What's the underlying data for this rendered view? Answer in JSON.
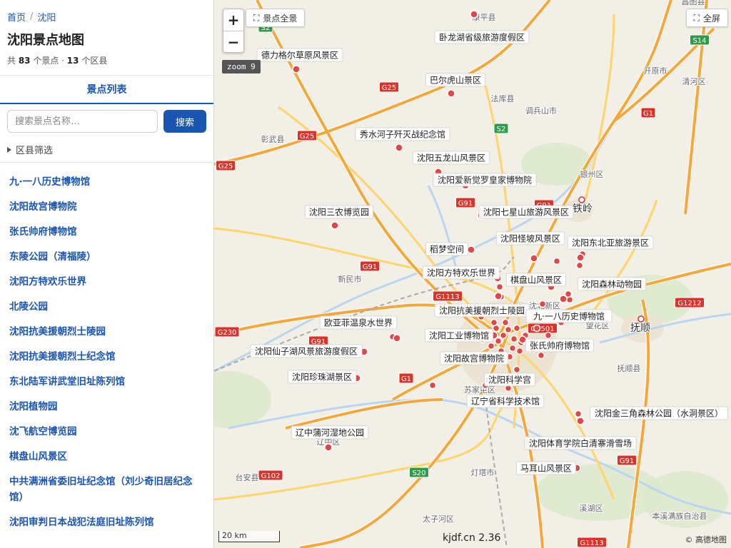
{
  "breadcrumb": {
    "home": "首页",
    "separator": "/",
    "current": "沈阳"
  },
  "title": "沈阳景点地图",
  "stats": {
    "prefix": "共 ",
    "spots": "83",
    "mid": " 个景点 · ",
    "districts": "13",
    "suffix": " 个区县"
  },
  "tab_label": "景点列表",
  "search": {
    "placeholder": "搜索景点名称…",
    "button": "搜索"
  },
  "filter_label": "区县筛选",
  "spots_list": [
    "九·一八历史博物馆",
    "沈阳故宫博物院",
    "张氏帅府博物馆",
    "东陵公园（清福陵）",
    "沈阳方特欢乐世界",
    "北陵公园",
    "沈阳抗美援朝烈士陵园",
    "沈阳抗美援朝烈士纪念馆",
    "东北陆军讲武堂旧址陈列馆",
    "沈阳植物园",
    "沈飞航空博览园",
    "棋盘山风景区",
    "中共满洲省委旧址纪念馆（刘少奇旧居纪念馆）",
    "沈阳审判日本战犯法庭旧址陈列馆"
  ],
  "map": {
    "zoom_in": "+",
    "zoom_out": "−",
    "fit_button": "景点全景",
    "fullscreen_button": "全屏",
    "zoom_badge": "zoom 9",
    "scale_label": "20 km",
    "brand": "kjdf.cn 2.36",
    "attribution": "© 高德地图",
    "spot_labels": [
      "德力格尔草原风景区",
      "卧龙湖省级旅游度假区",
      "巴尔虎山景区",
      "秀水河子歼灭战纪念馆",
      "沈阳五龙山风景区",
      "沈阳爱新觉罗皇家博物院",
      "沈阳三农博览园",
      "沈阳七星山旅游风景区",
      "沈阳怪坡风景区",
      "沈阳东北亚旅游景区",
      "稻梦空间",
      "沈阳方特欢乐世界",
      "棋盘山风景区",
      "沈阳森林动物园",
      "沈阳抗美援朝烈士陵园",
      "九·一八历史博物馆",
      "欧亚菲温泉水世界",
      "沈阳工业博物馆",
      "张氏帅府博物馆",
      "沈阳仙子湖风景旅游度假区",
      "沈阳故宫博物院",
      "沈阳珍珠湖景区",
      "沈阳科学宫",
      "辽宁省科学技术馆",
      "沈阳金三角森林公园（水洞景区）",
      "辽中蒲河湿地公园",
      "沈阳体育学院白清寨滑雪场",
      "马耳山风景区"
    ],
    "place_labels": [
      "康平县",
      "法库县",
      "调兵山市",
      "开原市",
      "清河区",
      "彰武县",
      "银州区",
      "铁岭",
      "新民市",
      "沈北新区",
      "望花区",
      "抚顺",
      "抚顺县",
      "苏家屯区",
      "辽中区",
      "台安县",
      "灯塔市",
      "太子河区",
      "溪湖区",
      "本溪满族自治县",
      "昌图县"
    ],
    "road_shields": [
      "S2",
      "G25",
      "G25",
      "G25",
      "S2",
      "G91",
      "G91",
      "G91",
      "G1113",
      "G1212",
      "G230",
      "G91",
      "G1",
      "G102",
      "S20",
      "G91",
      "S14",
      "G1",
      "G1501",
      "G1113"
    ]
  },
  "colors": {
    "accent": "#1a55b0",
    "marker": "#e04848",
    "highway": "#f4a73a",
    "road": "#ffd56a",
    "water": "#b9d6f0",
    "land": "#f2efe6",
    "green": "#d8e8c8"
  }
}
